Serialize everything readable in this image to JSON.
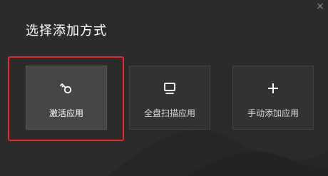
{
  "dialog": {
    "title": "选择添加方式",
    "close_glyph": "×"
  },
  "options": [
    {
      "label": "激活应用",
      "icon": "key-icon",
      "selected": true
    },
    {
      "label": "全盘扫描应用",
      "icon": "monitor-icon",
      "selected": false
    },
    {
      "label": "手动添加应用",
      "icon": "plus-icon",
      "selected": false
    }
  ],
  "colors": {
    "background": "#2b2b2b",
    "card": "#333333",
    "card_active": "#464646",
    "highlight": "#e8272a",
    "text": "#ffffff"
  }
}
